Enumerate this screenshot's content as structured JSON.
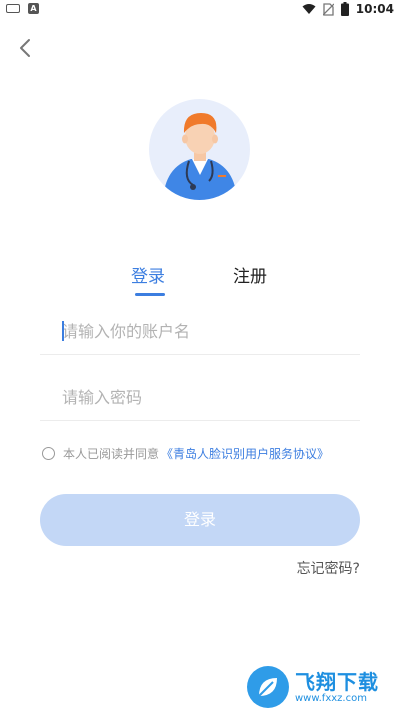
{
  "status_bar": {
    "notif_badge": "A",
    "time": "10:04",
    "icons": [
      "wifi-icon",
      "no-sim-icon",
      "battery-icon"
    ]
  },
  "nav": {
    "back_icon": "chevron-left-icon"
  },
  "avatar": {
    "icon": "doctor-avatar-icon"
  },
  "tabs": [
    {
      "label": "登录",
      "active": true
    },
    {
      "label": "注册",
      "active": false
    }
  ],
  "form": {
    "username_placeholder": "请输入你的账户名",
    "username_value": "",
    "password_placeholder": "请输入密码",
    "password_value": ""
  },
  "agreement": {
    "text": "本人已阅读并同意",
    "link": "《青岛人脸识别用户服务协议》",
    "checked": false
  },
  "login_button": {
    "label": "登录"
  },
  "forgot_password": {
    "label": "忘记密码?"
  },
  "watermark": {
    "main": "飞翔下载",
    "url": "www.fxxz.com"
  },
  "colors": {
    "accent": "#3c7ee0",
    "button_disabled": "#c3d7f6",
    "avatar_bg": "#e8eefb"
  }
}
